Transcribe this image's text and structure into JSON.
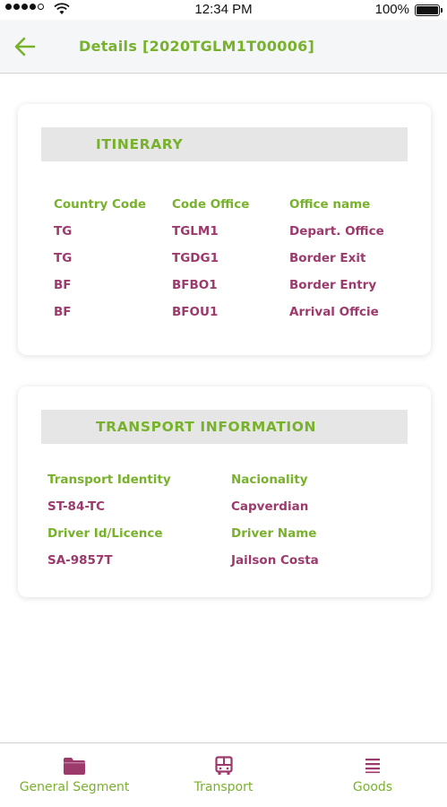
{
  "status_bar": {
    "time": "12:34 PM",
    "battery": "100%"
  },
  "header": {
    "title": "Details [2020TGLM1T00006]"
  },
  "itinerary": {
    "title": "ITINERARY",
    "columns": [
      "Country Code",
      "Code Office",
      "Office name"
    ],
    "rows": [
      [
        "TG",
        "TGLM1",
        "Depart. Office"
      ],
      [
        "TG",
        "TGDG1",
        "Border Exit"
      ],
      [
        "BF",
        "BFBO1",
        "Border Entry"
      ],
      [
        "BF",
        "BFOU1",
        "Arrival Offcie"
      ]
    ]
  },
  "transport": {
    "title": "TRANSPORT INFORMATION",
    "transport_identity_label": "Transport Identity",
    "transport_identity_value": "ST-84-TC",
    "nationality_label": "Nacionality",
    "nationality_value": "Capverdian",
    "driver_id_label": "Driver Id/Licence",
    "driver_id_value": "SA-9857T",
    "driver_name_label": "Driver Name",
    "driver_name_value": "Jailson Costa"
  },
  "nav": {
    "items": [
      {
        "label": "General Segment",
        "icon": "folder-icon"
      },
      {
        "label": "Transport",
        "icon": "bus-icon"
      },
      {
        "label": "Goods",
        "icon": "list-icon"
      }
    ]
  },
  "colors": {
    "accent": "#78b22c",
    "value": "#9c3a6c",
    "nav_icon": "#9c3a6c"
  }
}
